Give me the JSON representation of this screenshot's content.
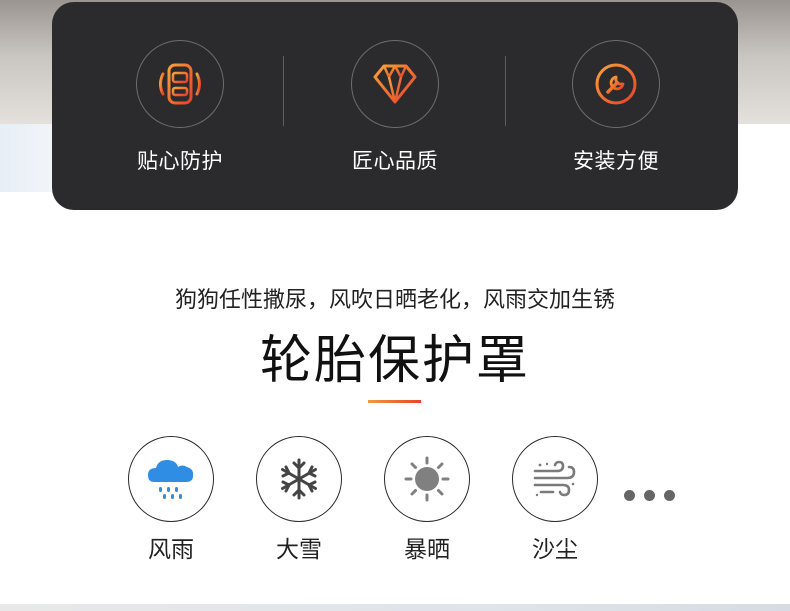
{
  "features": [
    {
      "label": "贴心防护",
      "icon": "car-shield-icon"
    },
    {
      "label": "匠心品质",
      "icon": "diamond-icon"
    },
    {
      "label": "安装方便",
      "icon": "wrench-icon"
    }
  ],
  "headline": {
    "subtitle": "狗狗任性撒尿，风吹日晒老化，风雨交加生锈",
    "title": "轮胎保护罩"
  },
  "weather": [
    {
      "label": "风雨",
      "icon": "rain-cloud-icon"
    },
    {
      "label": "大雪",
      "icon": "snowflake-icon"
    },
    {
      "label": "暴晒",
      "icon": "sun-icon"
    },
    {
      "label": "沙尘",
      "icon": "dust-wind-icon"
    }
  ],
  "colors": {
    "card_bg": "#2b2b2d",
    "accent_orange": "#f0632a",
    "rain_blue": "#2f8de4"
  }
}
